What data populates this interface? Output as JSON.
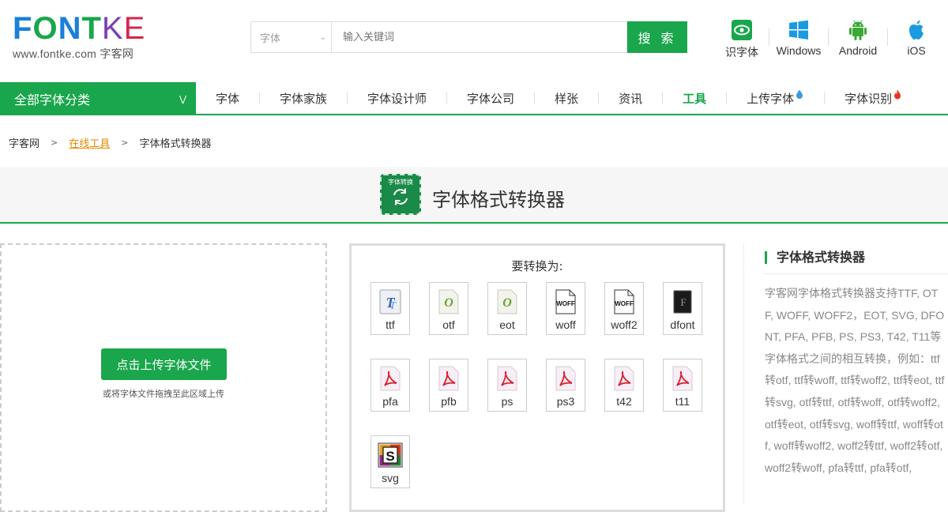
{
  "logo": {
    "letters": [
      "F",
      "O",
      "N",
      "T",
      "K",
      "E"
    ],
    "subtitle": "www.fontke.com 字客网"
  },
  "search": {
    "category": "字体",
    "placeholder": "输入关键词",
    "button": "搜 索"
  },
  "platforms": [
    {
      "label": "识字体",
      "icon": "eye-icon"
    },
    {
      "label": "Windows",
      "icon": "windows-icon"
    },
    {
      "label": "Android",
      "icon": "android-icon"
    },
    {
      "label": "iOS",
      "icon": "apple-icon"
    }
  ],
  "nav": {
    "all_label": "全部字体分类",
    "items": [
      "字体",
      "字体家族",
      "字体设计师",
      "字体公司",
      "样张",
      "资讯",
      "工具",
      "上传字体",
      "字体识别"
    ],
    "active": "工具"
  },
  "breadcrumb": {
    "home": "字客网",
    "tools": "在线工具",
    "current": "字体格式转换器"
  },
  "page": {
    "title": "字体格式转换器",
    "icon_label": "字体转换"
  },
  "upload": {
    "button": "点击上传字体文件",
    "hint": "或将字体文件拖拽至此区域上传"
  },
  "formats": {
    "title": "要转换为:",
    "items": [
      {
        "name": "ttf",
        "icon": "ttf-file-icon"
      },
      {
        "name": "otf",
        "icon": "otf-file-icon"
      },
      {
        "name": "eot",
        "icon": "eot-file-icon"
      },
      {
        "name": "woff",
        "icon": "woff-file-icon"
      },
      {
        "name": "woff2",
        "icon": "woff2-file-icon"
      },
      {
        "name": "dfont",
        "icon": "dfont-file-icon"
      },
      {
        "name": "pfa",
        "icon": "pdf-file-icon"
      },
      {
        "name": "pfb",
        "icon": "pdf-file-icon"
      },
      {
        "name": "ps",
        "icon": "pdf-file-icon"
      },
      {
        "name": "ps3",
        "icon": "pdf-file-icon"
      },
      {
        "name": "t42",
        "icon": "pdf-file-icon"
      },
      {
        "name": "t11",
        "icon": "pdf-file-icon"
      },
      {
        "name": "svg",
        "icon": "svg-file-icon"
      }
    ]
  },
  "sidebar": {
    "title": "字体格式转换器",
    "description": "字客网字体格式转换器支持TTF, OTF, WOFF, WOFF2，EOT, SVG, DFONT, PFA, PFB, PS, PS3, T42, T11等字体格式之间的相互转换，例如：ttf转otf, ttf转woff, ttf转woff2, ttf转eot, ttf转svg, otf转ttf, otf转woff, otf转woff2, otf转eot, otf转svg, woff转ttf, woff转otf, woff转woff2, woff2转ttf, woff2转otf, woff2转woff, pfa转ttf, pfa转otf,"
  },
  "colors": {
    "brand_green": "#1aa64c",
    "link_orange": "#e68a00"
  }
}
